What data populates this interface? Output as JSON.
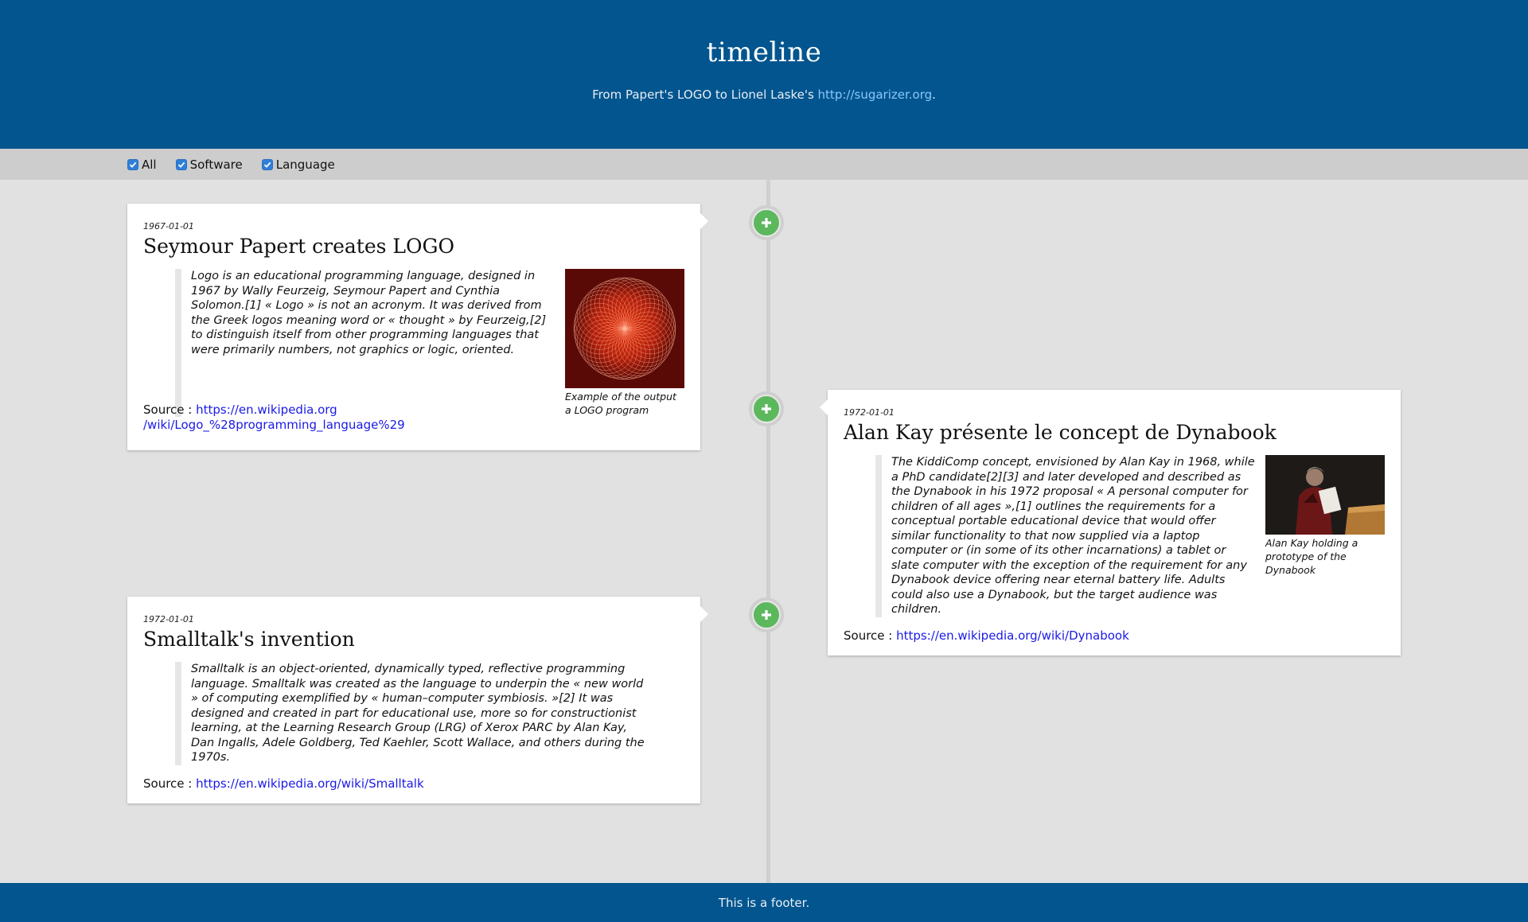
{
  "header": {
    "title": "timeline",
    "subtitle_prefix": "From Papert's LOGO to Lionel Laske's ",
    "subtitle_link": "http://sugarizer.org",
    "subtitle_suffix": "."
  },
  "filters": [
    {
      "label": "All",
      "checked": true
    },
    {
      "label": "Software",
      "checked": true
    },
    {
      "label": "Language",
      "checked": true
    }
  ],
  "events": [
    {
      "date": "1967-01-01",
      "title": "Seymour Papert creates LOGO",
      "text": "Logo is an educational programming language, designed in 1967 by Wally Feurzeig, Seymour Papert and Cynthia Solomon.[1] « Logo » is not an acronym. It was derived from the Greek logos meaning word or « thought » by Feurzeig,[2] to distinguish itself from other programming languages that were primarily numbers, not graphics or logic, oriented.",
      "caption": "Example of the output a LOGO program",
      "source_label": "Source : ",
      "source_link_line1": "https://en.wikipedia.org",
      "source_link_line2": "/wiki/Logo_%28programming_language%29"
    },
    {
      "date": "1972-01-01",
      "title": "Alan Kay présente le concept de Dynabook",
      "text": "The KiddiComp concept, envisioned by Alan Kay in 1968, while a PhD candidate[2][3] and later developed and described as the Dynabook in his 1972 proposal « A personal computer for children of all ages »,[1] outlines the requirements for a conceptual portable educational device that would offer similar functionality to that now supplied via a laptop computer or (in some of its other incarnations) a tablet or slate computer with the exception of the requirement for any Dynabook device offering near eternal battery life. Adults could also use a Dynabook, but the target audience was children.",
      "caption": "Alan Kay holding a prototype of the Dynabook",
      "source_label": "Source : ",
      "source_link": "https://en.wikipedia.org/wiki/Dynabook"
    },
    {
      "date": "1972-01-01",
      "title": "Smalltalk's invention",
      "text": "Smalltalk is an object-oriented, dynamically typed, reflective programming language. Smalltalk was created as the language to underpin the « new world » of computing exemplified by « human–computer symbiosis. »[2] It was designed and created in part for educational use, more so for constructionist learning, at the Learning Research Group (LRG) of Xerox PARC by Alan Kay, Dan Ingalls, Adele Goldberg, Ted Kaehler, Scott Wallace, and others during the 1970s.",
      "source_label": "Source : ",
      "source_link": "https://en.wikipedia.org/wiki/Smalltalk"
    }
  ],
  "footer": {
    "text": "This is a footer."
  },
  "colors": {
    "header_bg": "#02558e",
    "node_green": "#5cb85c",
    "link": "#1a1ae6"
  }
}
